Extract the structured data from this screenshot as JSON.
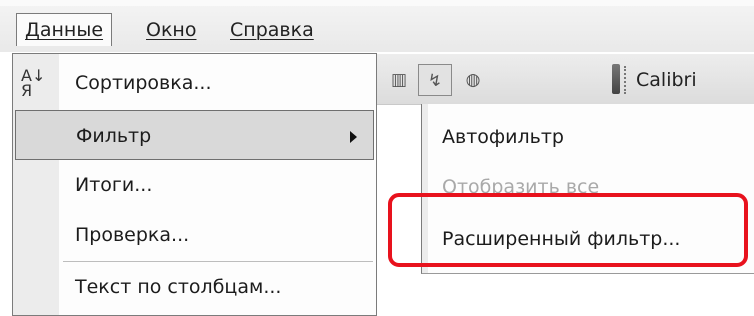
{
  "menubar": {
    "items": [
      {
        "label": "Данные",
        "open": true
      },
      {
        "label": "Окно",
        "open": false
      },
      {
        "label": "Справка",
        "open": false
      }
    ]
  },
  "toolbar": {
    "font_name": "Calibri",
    "icons": [
      "chart-icon",
      "chart-wizard-icon",
      "help-icon"
    ]
  },
  "data_menu": {
    "items": [
      {
        "label": "Сортировка...",
        "icon": "sort-icon"
      },
      {
        "label": "Фильтр",
        "submenu": true,
        "highlighted": true
      },
      {
        "label": "Итоги..."
      },
      {
        "label": "Проверка..."
      },
      {
        "label": "Текст по столбцам..."
      }
    ]
  },
  "filter_submenu": {
    "items": [
      {
        "label": "Автофильтр",
        "enabled": true
      },
      {
        "label": "Отобразить все",
        "enabled": false
      },
      {
        "label": "Расширенный фильтр...",
        "enabled": true,
        "annotated": true
      }
    ]
  },
  "annotation": {
    "color": "#e8121d"
  }
}
